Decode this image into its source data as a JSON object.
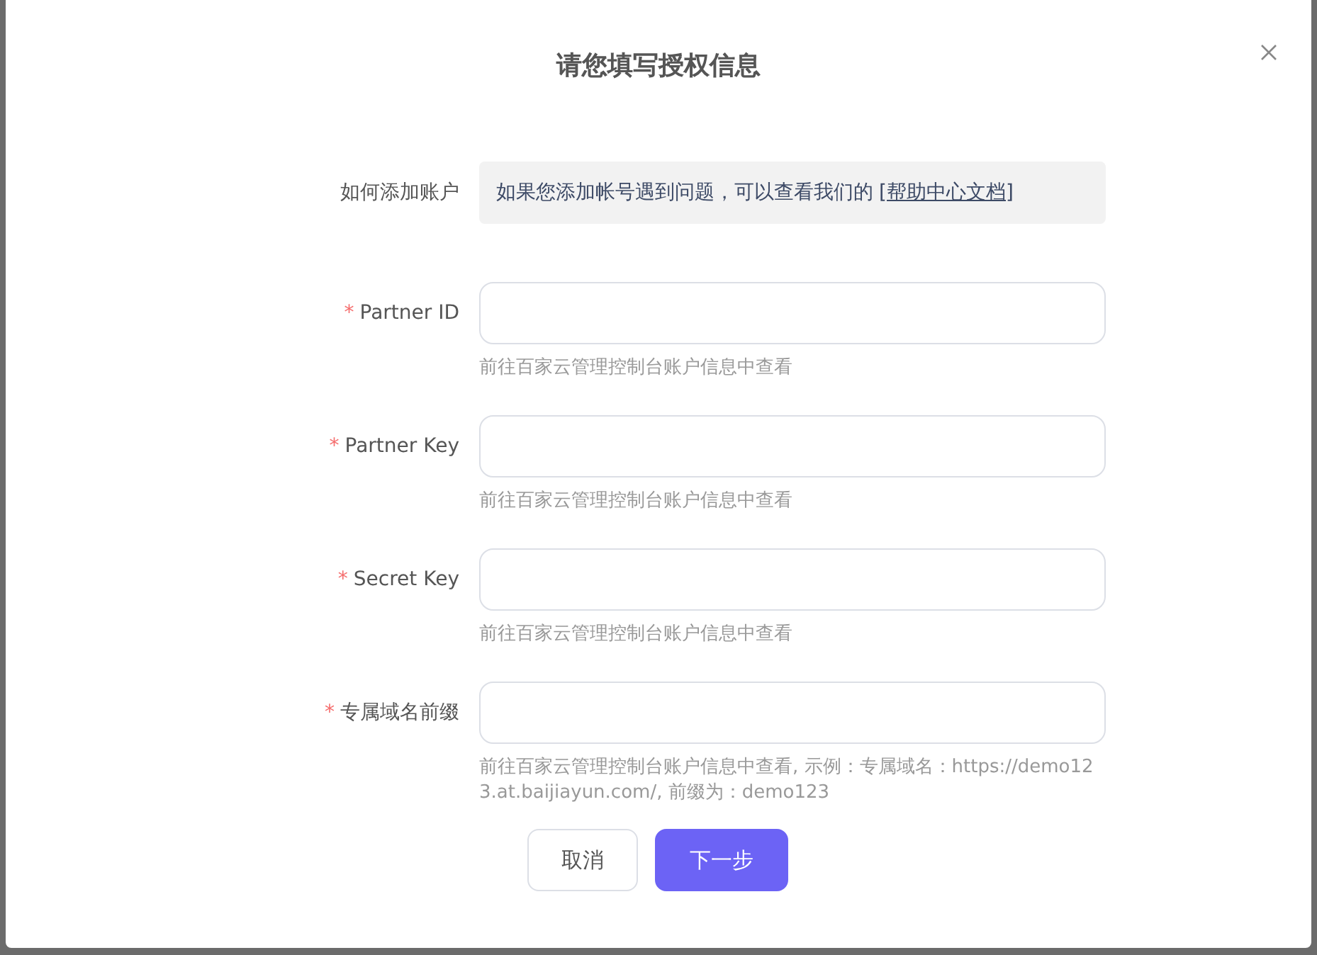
{
  "dialog": {
    "title": "请您填写授权信息"
  },
  "help": {
    "label": "如何添加账户",
    "text": "如果您添加帐号遇到问题，可以查看我们的",
    "link": "[帮助中心文档]"
  },
  "fields": [
    {
      "label": "Partner ID",
      "required_mark": "*",
      "hint": "前往百家云管理控制台账户信息中查看"
    },
    {
      "label": "Partner Key",
      "required_mark": "*",
      "hint": "前往百家云管理控制台账户信息中查看"
    },
    {
      "label": "Secret Key",
      "required_mark": "*",
      "hint": "前往百家云管理控制台账户信息中查看"
    },
    {
      "label": "专属域名前缀",
      "required_mark": "*",
      "hint": "前往百家云管理控制台账户信息中查看, 示例：专属域名：https://demo123.at.baijiayun.com/, 前缀为：demo123"
    }
  ],
  "buttons": [
    {
      "label": "取消",
      "kind": "secondary"
    },
    {
      "label": "下一步",
      "kind": "primary"
    }
  ]
}
